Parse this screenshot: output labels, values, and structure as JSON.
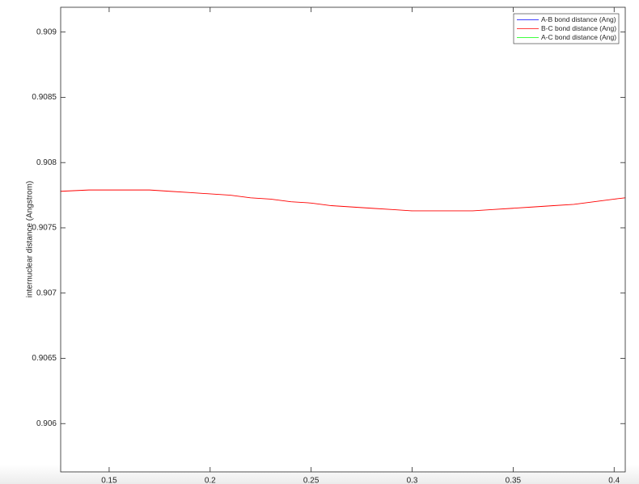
{
  "chart_data": {
    "type": "line",
    "title": "",
    "xlabel": "",
    "ylabel": "internuclear distance (Angstrom)",
    "xlim": [
      0.126,
      0.4055
    ],
    "ylim": [
      0.90563,
      0.90919
    ],
    "xticks": [
      {
        "value": 0.15,
        "label": "0.15"
      },
      {
        "value": 0.2,
        "label": "0.2"
      },
      {
        "value": 0.25,
        "label": "0.25"
      },
      {
        "value": 0.3,
        "label": "0.3"
      },
      {
        "value": 0.35,
        "label": "0.35"
      },
      {
        "value": 0.4,
        "label": "0.4"
      }
    ],
    "yticks": [
      {
        "value": 0.906,
        "label": "0.906"
      },
      {
        "value": 0.9065,
        "label": "0.9065"
      },
      {
        "value": 0.907,
        "label": "0.907"
      },
      {
        "value": 0.9075,
        "label": "0.9075"
      },
      {
        "value": 0.908,
        "label": "0.908"
      },
      {
        "value": 0.9085,
        "label": "0.9085"
      },
      {
        "value": 0.909,
        "label": "0.909"
      }
    ],
    "grid": false,
    "legend_position": "top-right",
    "series": [
      {
        "name": "A-B bond distance (Ang)",
        "color": "#0000ff",
        "x": [],
        "y": []
      },
      {
        "name": "B-C bond distance (Ang)",
        "color": "#ff0000",
        "x": [
          0.126,
          0.14,
          0.15,
          0.16,
          0.17,
          0.18,
          0.19,
          0.2,
          0.21,
          0.22,
          0.23,
          0.24,
          0.25,
          0.26,
          0.27,
          0.28,
          0.29,
          0.3,
          0.31,
          0.32,
          0.33,
          0.34,
          0.35,
          0.36,
          0.37,
          0.38,
          0.39,
          0.4,
          0.4055
        ],
        "y": [
          0.90778,
          0.90779,
          0.90779,
          0.90779,
          0.90779,
          0.90778,
          0.90777,
          0.90776,
          0.90775,
          0.90773,
          0.90772,
          0.9077,
          0.90769,
          0.90767,
          0.90766,
          0.90765,
          0.90764,
          0.90763,
          0.90763,
          0.90763,
          0.90763,
          0.90764,
          0.90765,
          0.90766,
          0.90767,
          0.90768,
          0.9077,
          0.90772,
          0.90773
        ]
      },
      {
        "name": "A-C bond distance (Ang)",
        "color": "#00ff00",
        "x": [],
        "y": []
      }
    ]
  }
}
